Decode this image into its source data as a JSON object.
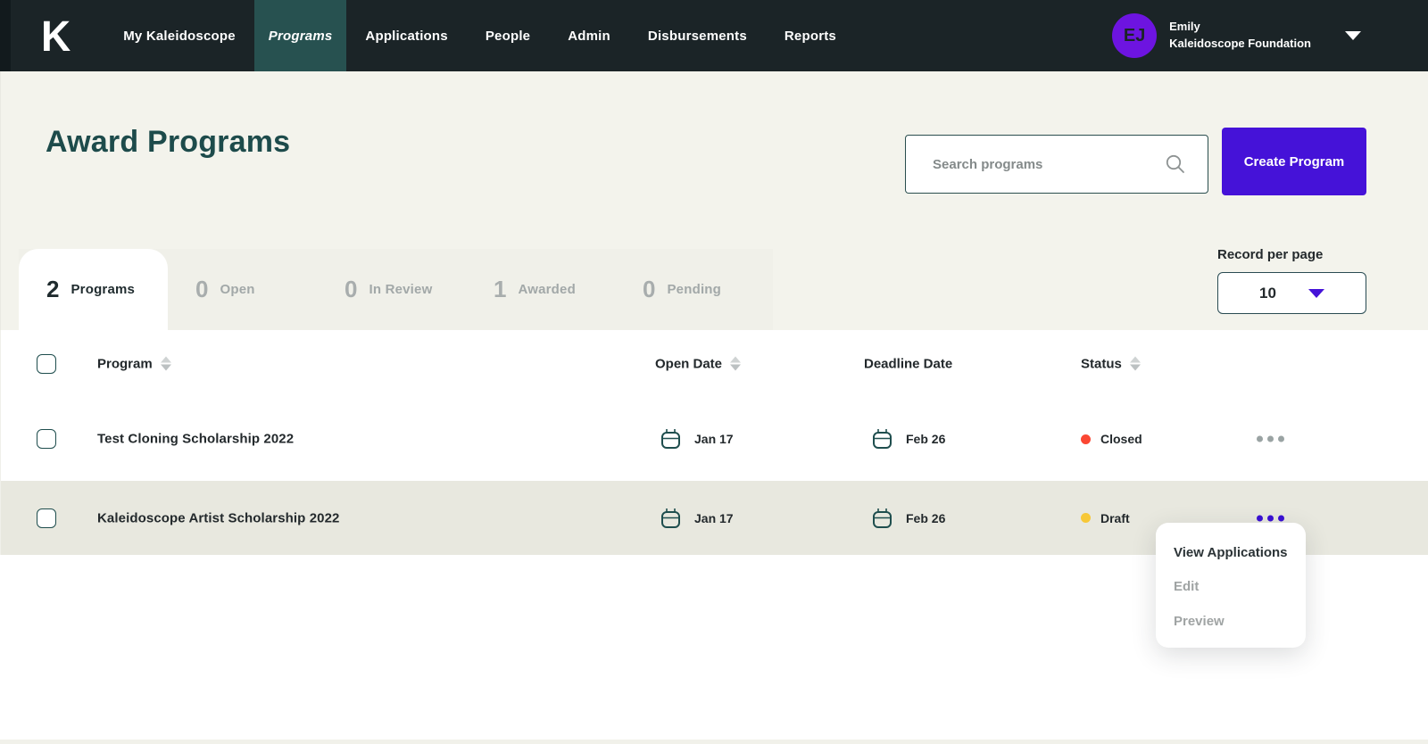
{
  "nav": {
    "logo": "K",
    "items": [
      {
        "label": "My Kaleidoscope",
        "active": false
      },
      {
        "label": "Programs",
        "active": true
      },
      {
        "label": "Applications",
        "active": false
      },
      {
        "label": "People",
        "active": false
      },
      {
        "label": "Admin",
        "active": false
      },
      {
        "label": "Disbursements",
        "active": false
      },
      {
        "label": "Reports",
        "active": false
      }
    ],
    "user": {
      "initials": "EJ",
      "name": "Emily",
      "org": "Kaleidoscope Foundation"
    }
  },
  "page": {
    "title": "Award Programs"
  },
  "search": {
    "placeholder": "Search programs"
  },
  "actions": {
    "create_label": "Create Program"
  },
  "pagination": {
    "label": "Record per page",
    "value": "10"
  },
  "tabs": [
    {
      "count": "2",
      "label": "Programs",
      "active": true
    },
    {
      "count": "0",
      "label": "Open",
      "active": false
    },
    {
      "count": "0",
      "label": "In Review",
      "active": false
    },
    {
      "count": "1",
      "label": "Awarded",
      "active": false
    },
    {
      "count": "0",
      "label": "Pending",
      "active": false
    }
  ],
  "table": {
    "headers": {
      "program": "Program",
      "open_date": "Open Date",
      "deadline_date": "Deadline Date",
      "status": "Status"
    },
    "rows": [
      {
        "name": "Test Cloning Scholarship 2022",
        "open_date": "Jan 17",
        "deadline_date": "Feb 26",
        "status": "Closed",
        "status_color": "#fb4733"
      },
      {
        "name": "Kaleidoscope Artist Scholarship 2022",
        "open_date": "Jan 17",
        "deadline_date": "Feb 26",
        "status": "Draft",
        "status_color": "#f7c838"
      }
    ]
  },
  "context_menu": {
    "items": [
      {
        "label": "View Applications",
        "enabled": true
      },
      {
        "label": "Edit",
        "enabled": false
      },
      {
        "label": "Preview",
        "enabled": false
      }
    ]
  },
  "colors": {
    "accent_purple": "#4512d8",
    "brand_teal": "#1d4b4b",
    "nav_bg": "#1b2427",
    "status_closed": "#fb4733",
    "status_draft": "#f7c838"
  }
}
